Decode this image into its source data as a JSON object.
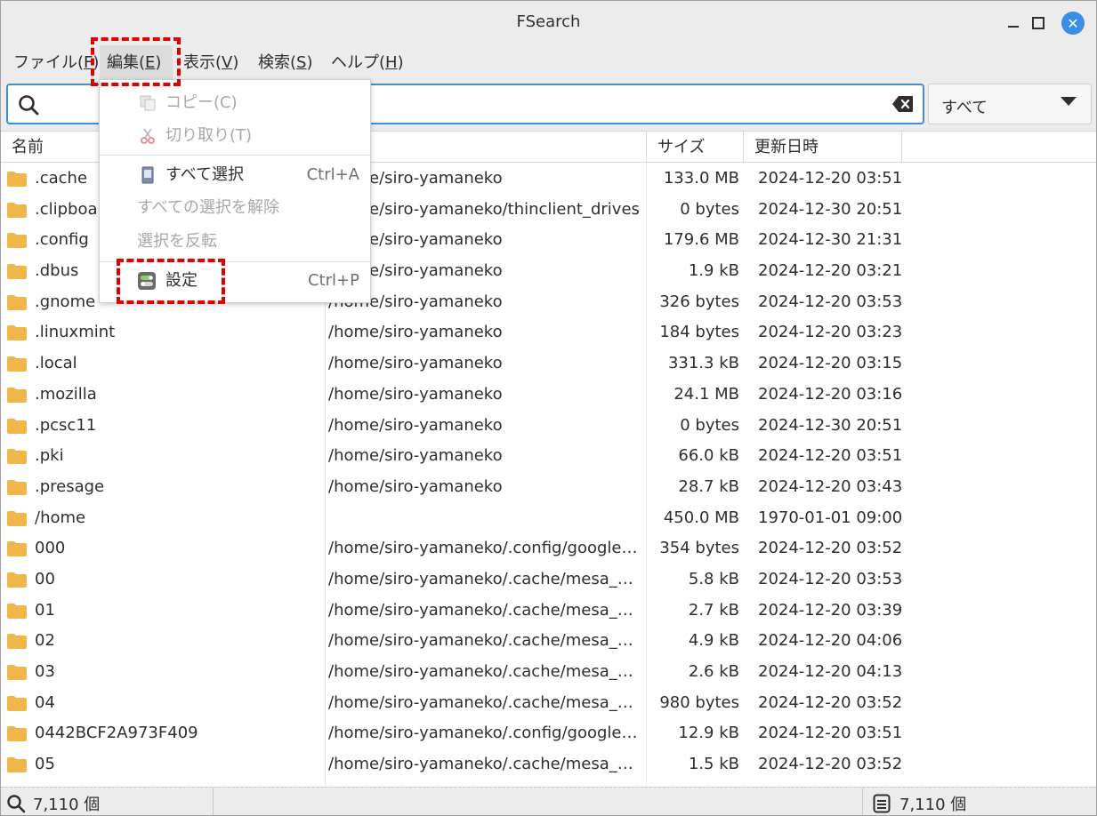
{
  "window": {
    "title": "FSearch"
  },
  "menubar": {
    "items": [
      {
        "label": "ファイル(",
        "key": "F",
        "suffix": ")"
      },
      {
        "label": "編集(",
        "key": "E",
        "suffix": ")"
      },
      {
        "label": "表示(",
        "key": "V",
        "suffix": ")"
      },
      {
        "label": "検索(",
        "key": "S",
        "suffix": ")"
      },
      {
        "label": "ヘルプ(",
        "key": "H",
        "suffix": ")"
      }
    ]
  },
  "search": {
    "value": "",
    "placeholder": ""
  },
  "filter": {
    "selected": "すべて"
  },
  "columns": {
    "name": "名前",
    "path": "",
    "size": "サイズ",
    "date": "更新日時"
  },
  "rows": [
    {
      "name": ".cache",
      "path": "/home/siro-yamaneko",
      "size": "133.0 MB",
      "date": "2024-12-20 03:51"
    },
    {
      "name": ".clipboard",
      "path": "/home/siro-yamaneko/thinclient_drives",
      "size": "0 bytes",
      "date": "2024-12-30 20:51"
    },
    {
      "name": ".config",
      "path": "/home/siro-yamaneko",
      "size": "179.6 MB",
      "date": "2024-12-30 21:31"
    },
    {
      "name": ".dbus",
      "path": "/home/siro-yamaneko",
      "size": "1.9 kB",
      "date": "2024-12-20 03:21"
    },
    {
      "name": ".gnome",
      "path": "/home/siro-yamaneko",
      "size": "326 bytes",
      "date": "2024-12-20 03:53"
    },
    {
      "name": ".linuxmint",
      "path": "/home/siro-yamaneko",
      "size": "184 bytes",
      "date": "2024-12-20 03:23"
    },
    {
      "name": ".local",
      "path": "/home/siro-yamaneko",
      "size": "331.3 kB",
      "date": "2024-12-20 03:15"
    },
    {
      "name": ".mozilla",
      "path": "/home/siro-yamaneko",
      "size": "24.1 MB",
      "date": "2024-12-20 03:16"
    },
    {
      "name": ".pcsc11",
      "path": "/home/siro-yamaneko",
      "size": "0 bytes",
      "date": "2024-12-30 20:51"
    },
    {
      "name": ".pki",
      "path": "/home/siro-yamaneko",
      "size": "66.0 kB",
      "date": "2024-12-20 03:51"
    },
    {
      "name": ".presage",
      "path": "/home/siro-yamaneko",
      "size": "28.7 kB",
      "date": "2024-12-20 03:43"
    },
    {
      "name": "/home",
      "path": "",
      "size": "450.0 MB",
      "date": "1970-01-01 09:00"
    },
    {
      "name": "000",
      "path": "/home/siro-yamaneko/.config/google-…",
      "size": "354 bytes",
      "date": "2024-12-20 03:52"
    },
    {
      "name": "00",
      "path": "/home/siro-yamaneko/.cache/mesa_s…",
      "size": "5.8 kB",
      "date": "2024-12-20 03:53"
    },
    {
      "name": "01",
      "path": "/home/siro-yamaneko/.cache/mesa_s…",
      "size": "2.7 kB",
      "date": "2024-12-20 03:39"
    },
    {
      "name": "02",
      "path": "/home/siro-yamaneko/.cache/mesa_s…",
      "size": "4.9 kB",
      "date": "2024-12-20 04:06"
    },
    {
      "name": "03",
      "path": "/home/siro-yamaneko/.cache/mesa_s…",
      "size": "2.6 kB",
      "date": "2024-12-20 04:13"
    },
    {
      "name": "04",
      "path": "/home/siro-yamaneko/.cache/mesa_s…",
      "size": "980 bytes",
      "date": "2024-12-20 03:52"
    },
    {
      "name": "0442BCF2A973F409",
      "path": "/home/siro-yamaneko/.config/google-…",
      "size": "12.9 kB",
      "date": "2024-12-20 03:51"
    },
    {
      "name": "05",
      "path": "/home/siro-yamaneko/.cache/mesa_s…",
      "size": "1.5 kB",
      "date": "2024-12-20 03:52"
    }
  ],
  "edit_menu": {
    "copy": "コピー(C)",
    "cut": "切り取り(T)",
    "select_all": "すべて選択",
    "select_all_shortcut": "Ctrl+A",
    "deselect_all": "すべての選択を解除",
    "invert_selection": "選択を反転",
    "preferences": "設定",
    "preferences_shortcut": "Ctrl+P"
  },
  "status": {
    "left_count": "7,110 個",
    "right_count": "7,110 個"
  },
  "colors": {
    "accent": "#3c8fd9",
    "folder": "#f0b64a",
    "highlight": "#e00000"
  }
}
